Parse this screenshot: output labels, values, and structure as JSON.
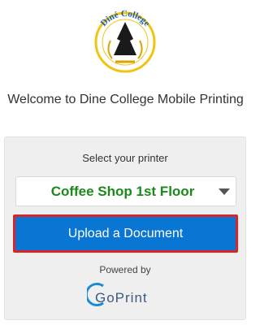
{
  "logo": {
    "text": "Diné College",
    "icon": "arrowhead-seal-icon",
    "colors": {
      "ring": "#f1c40f",
      "text": "#1a5fb4",
      "arrowhead": "#1a1a1a"
    }
  },
  "welcome_text": "Welcome to Dine College Mobile Printing",
  "card": {
    "select_label": "Select your printer",
    "printer": {
      "selected": "Coffee Shop 1st Floor",
      "color": "#1b8a1b"
    },
    "upload_label": "Upload a Document",
    "powered_by": "Powered by",
    "brand": {
      "text": "GoPrint",
      "color": "#3d5a80"
    }
  }
}
